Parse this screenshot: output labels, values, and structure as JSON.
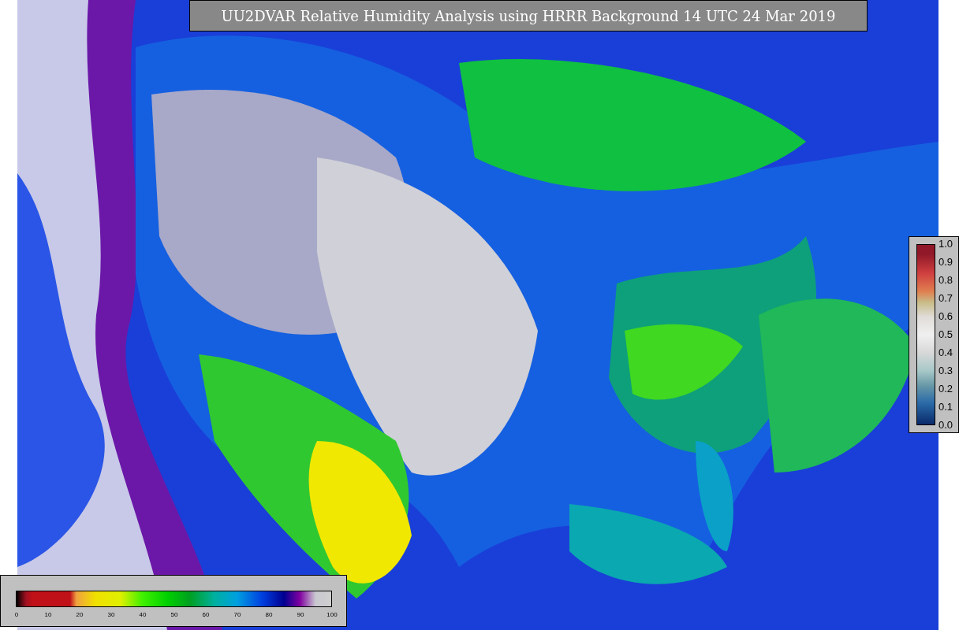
{
  "title": "UU2DVAR Relative Humidity Analysis using HRRR Background 14 UTC 24 Mar 2019",
  "observation_colorbar": {
    "ticks": [
      "1.0",
      "0.9",
      "0.8",
      "0.7",
      "0.6",
      "0.5",
      "0.4",
      "0.3",
      "0.2",
      "0.1",
      "0.0"
    ]
  },
  "humidity_colorbar": {
    "ticks": [
      "0",
      "10",
      "20",
      "30",
      "40",
      "50",
      "60",
      "70",
      "80",
      "90",
      "100"
    ]
  }
}
